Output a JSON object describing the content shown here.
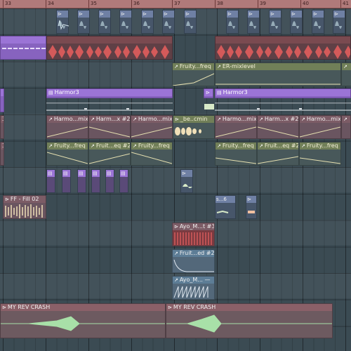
{
  "ruler": {
    "bar_numbers": [
      "33",
      "34",
      "35",
      "36",
      "37",
      "38",
      "39",
      "40",
      "41"
    ]
  },
  "clips": {
    "er_mixlevel": "ER-mixlevel",
    "fruity_freq_top": "Fruity...freq",
    "harmor3_a": "Harmor3",
    "harmor3_b": "Harmor3",
    "harmo_mix_1": "Harmo...mix",
    "harm_x2_1": "Harm...x #2",
    "harmo_mix_2": "Harmo...mix",
    "be_cmin": "_be..cmin",
    "harmo_mix_3": "Harmo...mix",
    "harm_x2_2": "Harm...x #2",
    "harmo_mix_4": "Harmo...mix",
    "fruity_freq_1": "Fruity...freq",
    "fruit_eq2_1": "Fruit...eq #2",
    "fruity_freq_2": "Fruity...freq",
    "fruity_freq_3": "Fruity...freq",
    "fruit_eq2_2": "Fruit...eq #2",
    "fruity_freq_4": "Fruity...freq",
    "ff_fill": "FF - Fill 02",
    "s6": "s...6",
    "ayo_mt3": "Ayo_M...t #3",
    "fruit_ed2": "Fruit...ed #2",
    "ayo_m": "Ayo_M... —",
    "rev_crash_1": "MY REV CRASH",
    "rev_crash_2": "MY REV CRASH",
    "edge_3a": "3",
    "edge_3b": "3"
  },
  "icons": {
    "sample": "waveform-glyph",
    "automation": "automation-curve-glyph",
    "pattern": "pattern-glyph"
  },
  "colors": {
    "background": "#3b4b53",
    "ruler": "#b07a7a",
    "pattern_clip": "#9b74d6",
    "audio_clip_header": "#7c5c66",
    "automation_line": "#e6e0b0",
    "waveform_red": "#d45a5a",
    "waveform_green": "#a8e0a8",
    "waveform_cream": "#f0e0b8"
  }
}
